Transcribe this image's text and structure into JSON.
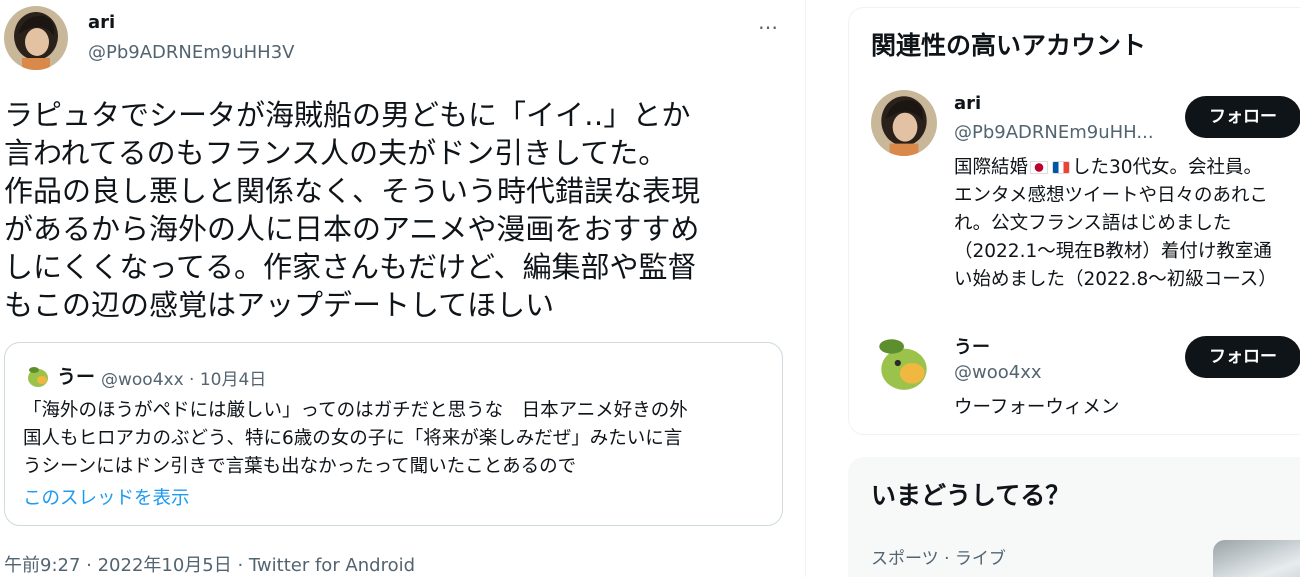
{
  "tweet": {
    "author_name": "ari",
    "author_handle": "@Pb9ADRNEm9uHH3V",
    "more_icon": "…",
    "text": "ラピュタでシータが海賊船の男どもに「イイ‥」とか\n言われてるのもフランス人の夫がドン引きしてた。\n作品の良し悪しと関係なく、そういう時代錯誤な表現\nがあるから海外の人に日本のアニメや漫画をおすすめ\nしにくくなってる。作家さんもだけど、編集部や監督\nもこの辺の感覚はアップデートしてほしい",
    "quote": {
      "name": "うー",
      "meta": "@woo4xx · 10月4日",
      "text": "「海外のほうがペドには厳しい」ってのはガチだと思うな　日本アニメ好きの外\n国人もヒロアカのぶどう、特に6歳の女の子に「将来が楽しみだぜ」みたいに言\nうシーンにはドン引きで言葉も出なかったって聞いたことあるので",
      "show_thread": "このスレッドを表示"
    },
    "timestamp": "午前9:27 · 2022年10月5日 · Twitter for Android"
  },
  "sidebar": {
    "related_title": "関連性の高いアカウント",
    "accounts": [
      {
        "name": "ari",
        "handle": "@Pb9ADRNEm9uHH...",
        "follow_label": "フォロー",
        "bio_prefix": "国際結婚",
        "bio_rest": "した30代女。会社員。\nエンタメ感想ツイートや日々のあれこ\nれ。公文フランス語はじめました\n（2022.1〜現在B教材）着付け教室通\nい始めました（2022.8〜初級コース）"
      },
      {
        "name": "うー",
        "handle": "@woo4xx",
        "follow_label": "フォロー",
        "bio": "ウーフォーウィメン"
      }
    ],
    "trends_title": "いまどうしてる？",
    "trend_category": "スポーツ · ライブ"
  },
  "colors": {
    "text": "#0f1419",
    "secondary": "#536471",
    "link": "#1d9bf0",
    "button_bg": "#0f1419",
    "border": "#cfd9de"
  },
  "icons": {
    "more": "more-horizontal-icon",
    "flag_jp": "japan-flag-icon",
    "flag_fr": "france-flag-icon"
  }
}
